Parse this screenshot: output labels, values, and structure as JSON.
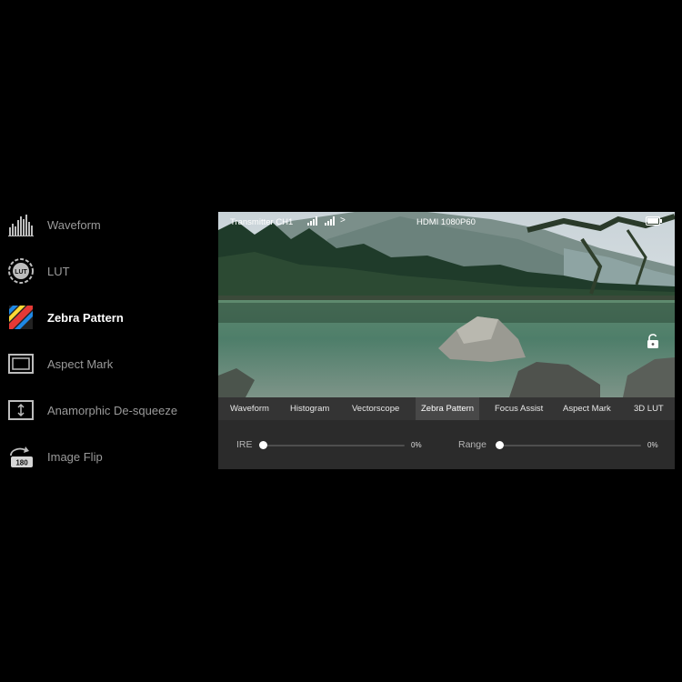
{
  "features": [
    {
      "label": "Waveform",
      "icon": "waveform-icon",
      "active": false
    },
    {
      "label": "LUT",
      "icon": "lut-icon",
      "icon_text": "LUT",
      "active": false
    },
    {
      "label": "Zebra Pattern",
      "icon": "zebra-pattern-icon",
      "active": true
    },
    {
      "label": "Aspect Mark",
      "icon": "aspect-mark-icon",
      "active": false
    },
    {
      "label": "Anamorphic De-squeeze",
      "icon": "anamorphic-desqueeze-icon",
      "active": false
    },
    {
      "label": "Image Flip",
      "icon": "image-flip-icon",
      "icon_text": "180",
      "active": false
    }
  ],
  "status": {
    "channel": "Transmitter CH1",
    "chevron": ">",
    "resolution": "HDMI 1080P60"
  },
  "tabs": [
    "Waveform",
    "Histogram",
    "Vectorscope",
    "Zebra Pattern",
    "Focus Assist",
    "Aspect Mark",
    "3D LUT"
  ],
  "active_tab": "Zebra Pattern",
  "controls": {
    "ire": {
      "label": "IRE",
      "value": "0%",
      "level": 0
    },
    "range": {
      "label": "Range",
      "value": "0%",
      "level": 0
    }
  },
  "colors": {
    "zebra_stripes": [
      "#e53935",
      "#fdd835",
      "#1e88e5"
    ],
    "active_label": "#ffffff",
    "inactive_label": "#9a9a9a"
  }
}
